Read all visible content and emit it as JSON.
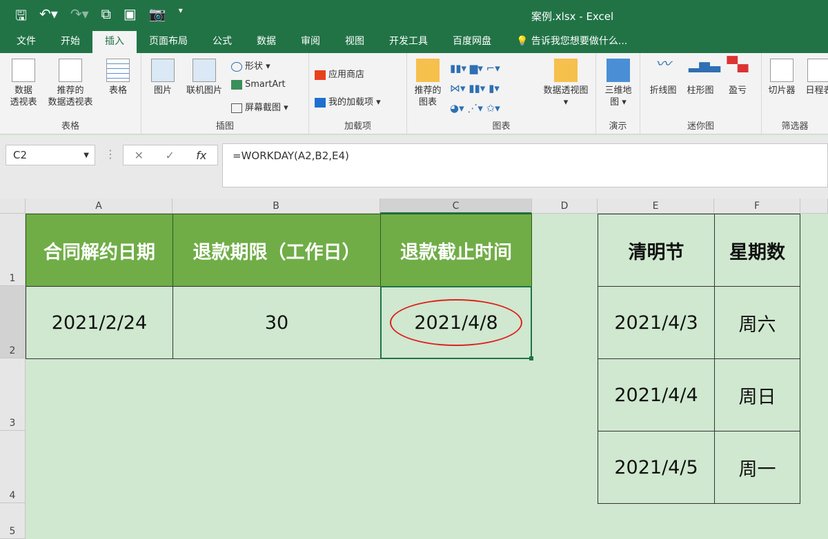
{
  "window": {
    "title": "案例.xlsx - Excel"
  },
  "tabs": [
    "文件",
    "开始",
    "插入",
    "页面布局",
    "公式",
    "数据",
    "审阅",
    "视图",
    "开发工具",
    "百度网盘"
  ],
  "tell_me": "告诉我您想要做什么...",
  "ribbon": {
    "tables": {
      "label": "表格",
      "buttons": [
        "数据\n透视表",
        "推荐的\n数据透视表",
        "表格"
      ]
    },
    "illustrations": {
      "label": "插图",
      "buttons": [
        "图片",
        "联机图片"
      ],
      "small": [
        "形状",
        "SmartArt",
        "屏幕截图"
      ]
    },
    "addins": {
      "label": "加载项",
      "small": [
        "应用商店",
        "我的加载项"
      ]
    },
    "charts": {
      "label": "图表",
      "buttons": [
        "推荐的\n图表",
        "数据透视图"
      ]
    },
    "tours": {
      "label": "演示",
      "buttons": [
        "三维地\n图"
      ]
    },
    "sparklines": {
      "label": "迷你图",
      "buttons": [
        "折线图",
        "柱形图",
        "盈亏"
      ]
    },
    "filters": {
      "label": "筛选器",
      "buttons": [
        "切片器",
        "日程表"
      ]
    }
  },
  "formula_bar": {
    "name_box": "C2",
    "formula": "=WORKDAY(A2,B2,E4)"
  },
  "columns": [
    "A",
    "B",
    "C",
    "D",
    "E",
    "F"
  ],
  "rows": [
    "1",
    "2",
    "3",
    "4",
    "5"
  ],
  "main_table": {
    "headers": [
      "合同解约日期",
      "退款期限（工作日）",
      "退款截止时间"
    ],
    "values": [
      "2021/2/24",
      "30",
      "2021/4/8"
    ]
  },
  "holiday_table": {
    "headers": [
      "清明节",
      "星期数"
    ],
    "rows": [
      [
        "2021/4/3",
        "周六"
      ],
      [
        "2021/4/4",
        "周日"
      ],
      [
        "2021/4/5",
        "周一"
      ]
    ]
  },
  "colors": {
    "excel_green": "#217346",
    "header_fill": "#70ad47",
    "sheet_bg": "#cfe8cf",
    "highlight": "#e02020"
  }
}
